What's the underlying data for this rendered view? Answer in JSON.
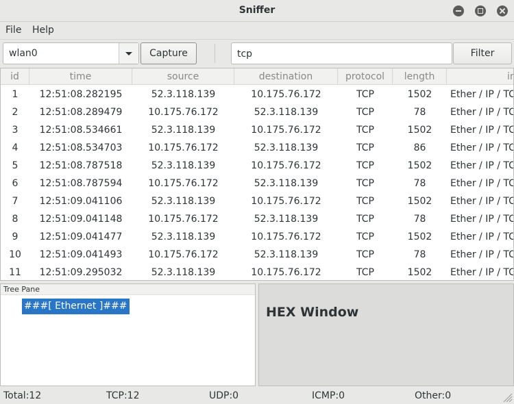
{
  "window": {
    "title": "Sniffer"
  },
  "menu": {
    "file": "File",
    "help": "Help"
  },
  "toolbar": {
    "interface": "wlan0",
    "capture_label": "Capture",
    "filter_value": "tcp",
    "filter_label": "Filter"
  },
  "table": {
    "columns": [
      "id",
      "time",
      "source",
      "destination",
      "protocol",
      "length",
      "info"
    ],
    "rows": [
      [
        "1",
        "12:51:08.282195",
        "52.3.118.139",
        "10.175.76.172",
        "TCP",
        "1502",
        "Ether / IP / TCP"
      ],
      [
        "2",
        "12:51:08.289479",
        "10.175.76.172",
        "52.3.118.139",
        "TCP",
        "78",
        "Ether / IP / TCP"
      ],
      [
        "3",
        "12:51:08.534661",
        "52.3.118.139",
        "10.175.76.172",
        "TCP",
        "1502",
        "Ether / IP / TCP"
      ],
      [
        "4",
        "12:51:08.534703",
        "10.175.76.172",
        "52.3.118.139",
        "TCP",
        "86",
        "Ether / IP / TCP"
      ],
      [
        "5",
        "12:51:08.787518",
        "52.3.118.139",
        "10.175.76.172",
        "TCP",
        "1502",
        "Ether / IP / TCP"
      ],
      [
        "6",
        "12:51:08.787594",
        "10.175.76.172",
        "52.3.118.139",
        "TCP",
        "78",
        "Ether / IP / TCP"
      ],
      [
        "7",
        "12:51:09.041106",
        "52.3.118.139",
        "10.175.76.172",
        "TCP",
        "1502",
        "Ether / IP / TCP"
      ],
      [
        "8",
        "12:51:09.041148",
        "10.175.76.172",
        "52.3.118.139",
        "TCP",
        "78",
        "Ether / IP / TCP"
      ],
      [
        "9",
        "12:51:09.041477",
        "52.3.118.139",
        "10.175.76.172",
        "TCP",
        "1502",
        "Ether / IP / TCP"
      ],
      [
        "10",
        "12:51:09.041493",
        "10.175.76.172",
        "52.3.118.139",
        "TCP",
        "78",
        "Ether / IP / TCP"
      ],
      [
        "11",
        "12:51:09.295032",
        "52.3.118.139",
        "10.175.76.172",
        "TCP",
        "1502",
        "Ether / IP / TCP"
      ]
    ]
  },
  "tree_pane": {
    "label": "Tree Pane",
    "node": "###[ Ethernet ]###"
  },
  "hex_pane": {
    "title": "HEX Window"
  },
  "status": {
    "total": "Total:12",
    "tcp": "TCP:12",
    "udp": "UDP:0",
    "icmp": "ICMP:0",
    "other": "Other:0"
  },
  "icons": [
    "minimize-icon",
    "maximize-icon",
    "close-icon",
    "dropdown-arrow-icon",
    "resize-grip-icon"
  ]
}
